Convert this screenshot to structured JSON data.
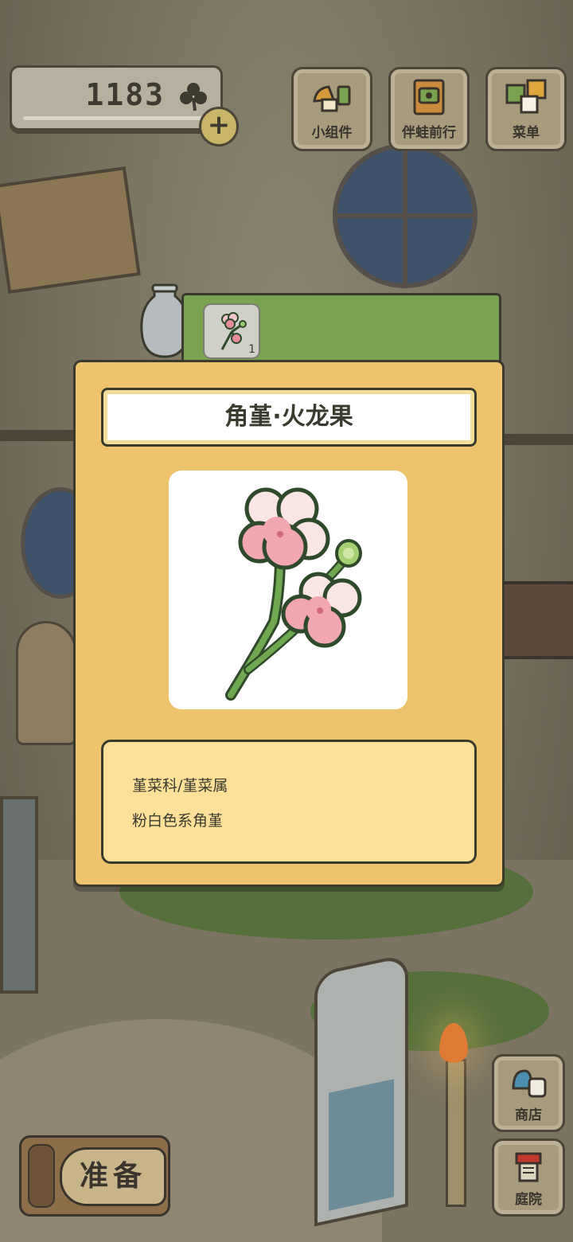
{
  "hud": {
    "clover_count": "1183",
    "clover_icon": "clover-icon",
    "plus_icon": "plus-icon",
    "plus_symbol": "+"
  },
  "top_menu": {
    "widgets_label": "小组件",
    "travel_label": "伴蛙前行",
    "menu_label": "菜单"
  },
  "side_menu": {
    "shop_label": "商店",
    "garden_label": "庭院"
  },
  "prepare_label": "准备",
  "item_tabs": {
    "selected_count": "1"
  },
  "item_detail": {
    "name": "角堇·火龙果",
    "family": "堇菜科/堇菜属",
    "description": "粉白色系角堇"
  },
  "colors": {
    "panel": "#edc46b",
    "tab_bar": "#7aa351",
    "desc_box": "#fde09a",
    "outline": "#3b3a2f"
  }
}
